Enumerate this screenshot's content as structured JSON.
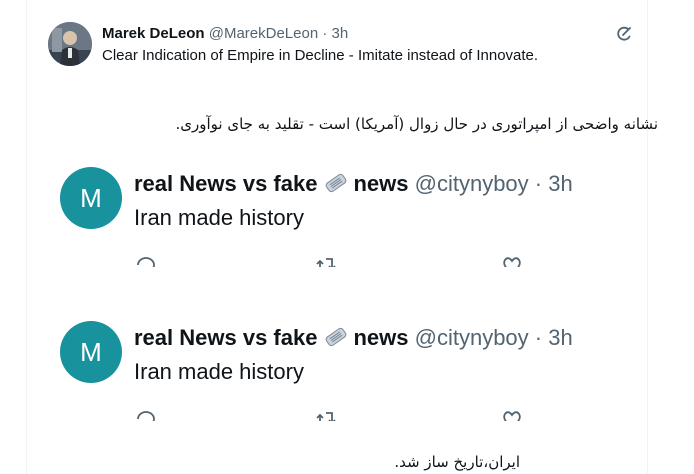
{
  "header_tweet": {
    "name": "Marek DeLeon",
    "handle": "@MarekDeLeon",
    "separator": " · ",
    "time": "3h",
    "text": "Clear Indication of Empire in Decline - Imitate instead of Innovate.",
    "avatar_icon": "profile-photo",
    "more_icon": "grok-icon"
  },
  "persian_text_1": "نشانه واضحی از امپراتوری در حال زوال (آمریکا) است - تقلید به جای نوآوری.",
  "quoted_tweets": [
    {
      "avatar_letter": "M",
      "name_part1": "real News vs fake",
      "name_part2": "news",
      "handle": "@citynyboy",
      "separator": " · ",
      "time": "3h",
      "text": "Iran made history",
      "avatar_color": "#18929c"
    },
    {
      "avatar_letter": "M",
      "name_part1": "real News vs fake",
      "name_part2": "news",
      "handle": "@citynyboy",
      "separator": " · ",
      "time": "3h",
      "text": "Iran made history",
      "avatar_color": "#18929c"
    }
  ],
  "persian_text_2": "ایران،تاریخ ساز شد."
}
